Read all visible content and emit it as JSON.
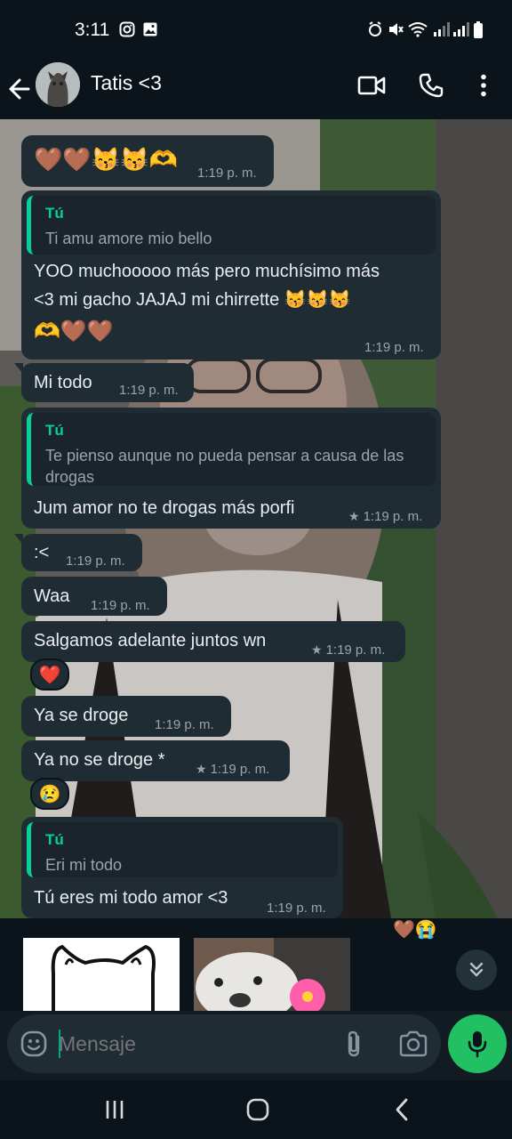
{
  "status_bar": {
    "time": "3:11"
  },
  "header": {
    "contact_name": "Tatis <3"
  },
  "messages": [
    {
      "emoji": "🤎🤎😽😽🫶",
      "time": "1:19 p. m."
    },
    {
      "quote_author": "Tú",
      "quote_text": "Ti amu amore mio bello",
      "text_line1": "YOO muchooooo más pero muchísimo más",
      "text_line2": "<3 mi gacho JAJAJ mi chirrette 😽😽😽",
      "text_line3": "🫶🤎🤎",
      "time": "1:19 p. m."
    },
    {
      "text": "Mi todo",
      "time": "1:19 p. m."
    },
    {
      "quote_author": "Tú",
      "quote_text": "Te pienso aunque no pueda pensar a causa de las drogas",
      "text": "Jum amor no te drogas más porfi",
      "time": "1:19 p. m.",
      "starred": true
    },
    {
      "text": ":<",
      "time": "1:19 p. m."
    },
    {
      "text": "Waa",
      "time": "1:19 p. m."
    },
    {
      "text": "Salgamos adelante juntos wn",
      "time": "1:19 p. m.",
      "starred": true,
      "reaction": "❤️"
    },
    {
      "text": "Ya se droge",
      "time": "1:19 p. m."
    },
    {
      "text": "Ya no se droge *",
      "time": "1:19 p. m.",
      "starred": true,
      "reaction": "😢"
    },
    {
      "quote_author": "Tú",
      "quote_text": "Eri mi todo",
      "text": "Tú eres mi todo amor <3",
      "time": "1:19 p. m.",
      "reaction": "🤎😭"
    }
  ],
  "composer": {
    "placeholder": "Mensaje"
  },
  "icons": {
    "back": "arrow-left-icon",
    "video": "video-call-icon",
    "call": "phone-icon",
    "menu": "more-vertical-icon",
    "emoji": "emoji-icon",
    "attach": "paperclip-icon",
    "camera": "camera-icon",
    "mic": "microphone-icon",
    "scroll": "double-chevron-down-icon"
  },
  "colors": {
    "accent": "#21c063",
    "bubble": "#202c33",
    "quote_bar": "#06cf9c",
    "background": "#0b141a"
  }
}
